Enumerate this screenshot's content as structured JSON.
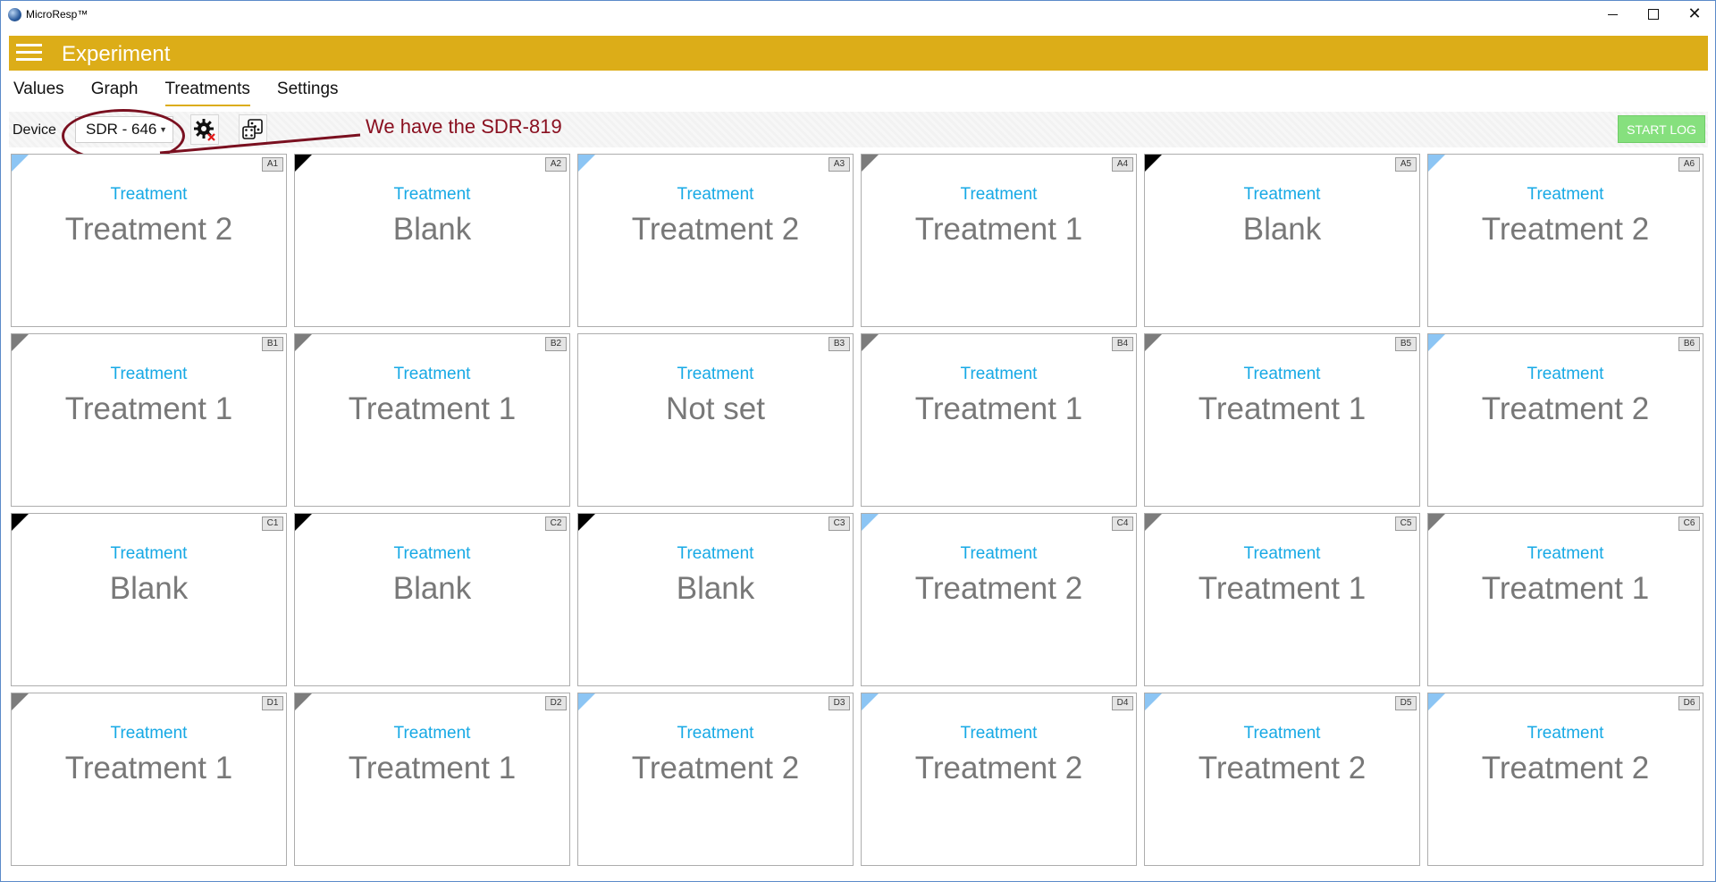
{
  "window": {
    "title": "MicroResp™"
  },
  "appbar": {
    "title": "Experiment",
    "color": "#dcad18"
  },
  "tabs": [
    {
      "label": "Values",
      "active": false
    },
    {
      "label": "Graph",
      "active": false
    },
    {
      "label": "Treatments",
      "active": true
    },
    {
      "label": "Settings",
      "active": false
    }
  ],
  "toolbar": {
    "device_label": "Device",
    "device_value": "SDR - 646",
    "start_log_label": "START LOG",
    "start_log_color": "#86e07e"
  },
  "annotation": {
    "text": "We have the SDR-819",
    "color": "#8a1020"
  },
  "colors": {
    "blue_tag": "#8cc5f4",
    "black_tag": "#000000",
    "gray_tag": "#7c7c7c",
    "label": "#17a9e5",
    "value": "#787878"
  },
  "wells": [
    {
      "id": "A1",
      "label": "Treatment",
      "value": "Treatment 2",
      "tag": "blue"
    },
    {
      "id": "A2",
      "label": "Treatment",
      "value": "Blank",
      "tag": "black"
    },
    {
      "id": "A3",
      "label": "Treatment",
      "value": "Treatment 2",
      "tag": "blue"
    },
    {
      "id": "A4",
      "label": "Treatment",
      "value": "Treatment 1",
      "tag": "gray"
    },
    {
      "id": "A5",
      "label": "Treatment",
      "value": "Blank",
      "tag": "black"
    },
    {
      "id": "A6",
      "label": "Treatment",
      "value": "Treatment 2",
      "tag": "blue"
    },
    {
      "id": "B1",
      "label": "Treatment",
      "value": "Treatment 1",
      "tag": "gray"
    },
    {
      "id": "B2",
      "label": "Treatment",
      "value": "Treatment 1",
      "tag": "gray"
    },
    {
      "id": "B3",
      "label": "Treatment",
      "value": "Not set",
      "tag": "none"
    },
    {
      "id": "B4",
      "label": "Treatment",
      "value": "Treatment 1",
      "tag": "gray"
    },
    {
      "id": "B5",
      "label": "Treatment",
      "value": "Treatment 1",
      "tag": "gray"
    },
    {
      "id": "B6",
      "label": "Treatment",
      "value": "Treatment 2",
      "tag": "blue"
    },
    {
      "id": "C1",
      "label": "Treatment",
      "value": "Blank",
      "tag": "black"
    },
    {
      "id": "C2",
      "label": "Treatment",
      "value": "Blank",
      "tag": "black"
    },
    {
      "id": "C3",
      "label": "Treatment",
      "value": "Blank",
      "tag": "black"
    },
    {
      "id": "C4",
      "label": "Treatment",
      "value": "Treatment 2",
      "tag": "blue"
    },
    {
      "id": "C5",
      "label": "Treatment",
      "value": "Treatment 1",
      "tag": "gray"
    },
    {
      "id": "C6",
      "label": "Treatment",
      "value": "Treatment 1",
      "tag": "gray"
    },
    {
      "id": "D1",
      "label": "Treatment",
      "value": "Treatment 1",
      "tag": "gray"
    },
    {
      "id": "D2",
      "label": "Treatment",
      "value": "Treatment 1",
      "tag": "gray"
    },
    {
      "id": "D3",
      "label": "Treatment",
      "value": "Treatment 2",
      "tag": "blue"
    },
    {
      "id": "D4",
      "label": "Treatment",
      "value": "Treatment 2",
      "tag": "blue"
    },
    {
      "id": "D5",
      "label": "Treatment",
      "value": "Treatment 2",
      "tag": "blue"
    },
    {
      "id": "D6",
      "label": "Treatment",
      "value": "Treatment 2",
      "tag": "blue"
    }
  ]
}
